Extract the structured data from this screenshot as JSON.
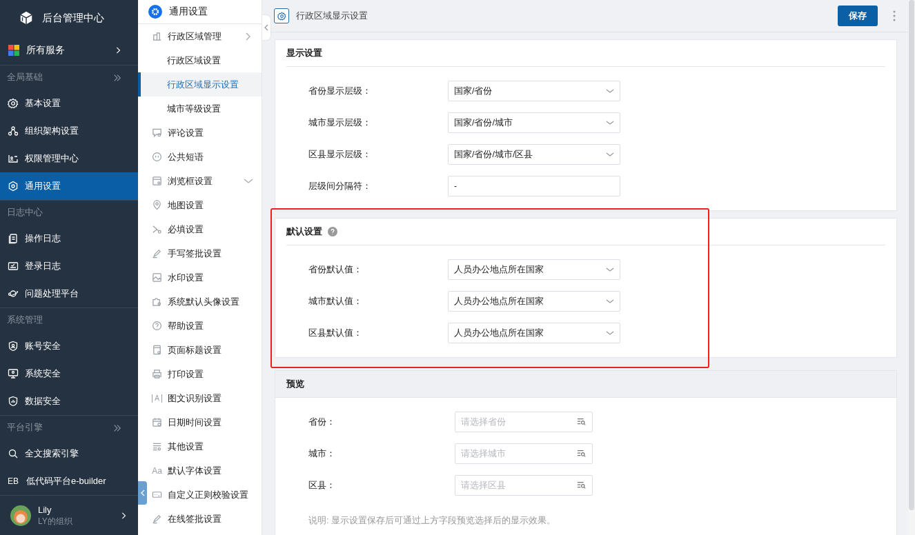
{
  "sidebar": {
    "title": "后台管理中心",
    "services": {
      "label": "所有服务"
    },
    "sections": [
      {
        "label": "全局基础",
        "collapsible": true,
        "items": [
          {
            "label": "基本设置",
            "selected": false
          },
          {
            "label": "组织架构设置",
            "selected": false
          },
          {
            "label": "权限管理中心",
            "selected": false
          },
          {
            "label": "通用设置",
            "selected": true
          }
        ]
      },
      {
        "label": "日志中心",
        "collapsible": false,
        "items": [
          {
            "label": "操作日志",
            "selected": false
          },
          {
            "label": "登录日志",
            "selected": false
          },
          {
            "label": "问题处理平台",
            "selected": false
          }
        ]
      },
      {
        "label": "系统管理",
        "collapsible": false,
        "items": [
          {
            "label": "账号安全",
            "selected": false
          },
          {
            "label": "系统安全",
            "selected": false
          },
          {
            "label": "数据安全",
            "selected": false
          }
        ]
      },
      {
        "label": "平台引擎",
        "collapsible": true,
        "items": [
          {
            "label": "全文搜索引擎",
            "selected": false
          },
          {
            "label": "低代码平台e-builder",
            "selected": false,
            "kind": "text-icon",
            "icon_text": "EB"
          }
        ]
      }
    ],
    "user": {
      "name": "Lily",
      "org": "LY的组织"
    }
  },
  "submenu": {
    "title": "通用设置",
    "items": [
      {
        "label": "行政区域管理",
        "expanded": true,
        "children": [
          {
            "label": "行政区域设置",
            "selected": false
          },
          {
            "label": "行政区域显示设置",
            "selected": true
          },
          {
            "label": "城市等级设置",
            "selected": false
          }
        ]
      },
      {
        "label": "评论设置"
      },
      {
        "label": "公共短语"
      },
      {
        "label": "浏览框设置",
        "expanded": false
      },
      {
        "label": "地图设置"
      },
      {
        "label": "必填设置"
      },
      {
        "label": "手写签批设置"
      },
      {
        "label": "水印设置"
      },
      {
        "label": "系统默认头像设置"
      },
      {
        "label": "帮助设置"
      },
      {
        "label": "页面标题设置"
      },
      {
        "label": "打印设置"
      },
      {
        "label": "图文识别设置",
        "icon_text": "A"
      },
      {
        "label": "日期时间设置"
      },
      {
        "label": "其他设置"
      },
      {
        "label": "默认字体设置",
        "icon_text": "Aa"
      },
      {
        "label": "自定义正则校验设置"
      },
      {
        "label": "在线签批设置"
      }
    ]
  },
  "page": {
    "title": "行政区域显示设置",
    "save_button": "保存",
    "cards": [
      {
        "title": "显示设置",
        "help": false,
        "fields": [
          {
            "label": "省份显示层级：",
            "kind": "select",
            "value": "国家/省份"
          },
          {
            "label": "城市显示层级：",
            "kind": "select",
            "value": "国家/省份/城市"
          },
          {
            "label": "区县显示层级：",
            "kind": "select",
            "value": "国家/省份/城市/区县"
          },
          {
            "label": "层级间分隔符：",
            "kind": "text",
            "value": "-"
          }
        ]
      },
      {
        "title": "默认设置",
        "help": true,
        "highlighted": true,
        "fields": [
          {
            "label": "省份默认值：",
            "kind": "select",
            "value": "人员办公地点所在国家"
          },
          {
            "label": "城市默认值：",
            "kind": "select",
            "value": "人员办公地点所在国家"
          },
          {
            "label": "区县默认值：",
            "kind": "select",
            "value": "人员办公地点所在国家"
          }
        ]
      },
      {
        "title": "预览",
        "help": false,
        "header_shaded": true,
        "fields": [
          {
            "label": "省份：",
            "kind": "browse",
            "placeholder": "请选择省份"
          },
          {
            "label": "城市：",
            "kind": "browse",
            "placeholder": "请选择城市"
          },
          {
            "label": "区县：",
            "kind": "browse",
            "placeholder": "请选择区县"
          }
        ],
        "note": "说明: 显示设置保存后可通过上方字段预览选择后的显示效果。"
      }
    ]
  }
}
